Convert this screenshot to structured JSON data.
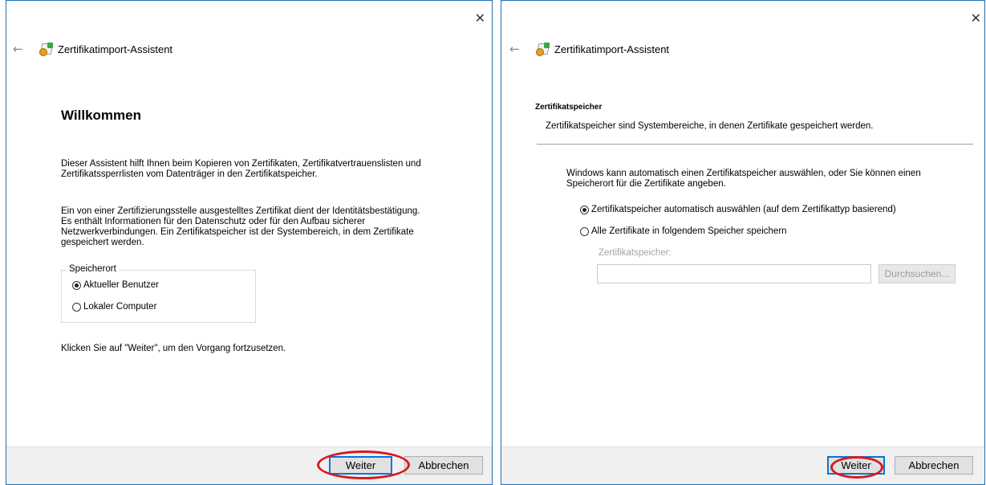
{
  "left_window": {
    "title": "Zertifikatimport-Assistent",
    "close_glyph": "✕",
    "back_glyph": "←",
    "heading": "Willkommen",
    "para1_line1": "Dieser Assistent hilft Ihnen beim Kopieren von Zertifikaten, Zertifikatvertrauenslisten und",
    "para1_line2": "Zertifikatssperrlisten vom Datenträger in den Zertifikatspeicher.",
    "para2_line1": "Ein von einer Zertifizierungsstelle ausgestelltes Zertifikat dient der Identitätsbestätigung.",
    "para2_line2": "Es enthält Informationen für den Datenschutz oder für den Aufbau sicherer",
    "para2_line3": "Netzwerkverbindungen. Ein Zertifikatspeicher ist der Systembereich, in dem Zertifikate",
    "para2_line4": "gespeichert werden.",
    "group_label": "Speicherort",
    "option_current_user": "Aktueller Benutzer",
    "option_local_computer": "Lokaler Computer",
    "selected_option": "Aktueller Benutzer",
    "continue_text": "Klicken Sie auf \"Weiter\", um den Vorgang fortzusetzen.",
    "next_label": "Weiter",
    "cancel_label": "Abbrechen"
  },
  "right_window": {
    "title": "Zertifikatimport-Assistent",
    "close_glyph": "✕",
    "back_glyph": "←",
    "section_title": "Zertifikatspeicher",
    "section_desc": "Zertifikatspeicher sind Systembereiche, in denen Zertifikate gespeichert werden.",
    "intro_line1": "Windows kann automatisch einen Zertifikatspeicher auswählen, oder Sie können einen",
    "intro_line2": "Speicherort für die Zertifikate angeben.",
    "option_auto": "Zertifikatspeicher automatisch auswählen (auf dem Zertifikattyp basierend)",
    "option_manual": "Alle Zertifikate in folgendem Speicher speichern",
    "selected_option": "Zertifikatspeicher automatisch auswählen (auf dem Zertifikattyp basierend)",
    "store_label": "Zertifikatspeicher:",
    "store_value": "",
    "browse_label": "Durchsuchen...",
    "next_label": "Weiter",
    "cancel_label": "Abbrechen"
  },
  "colors": {
    "window_border": "#1f6fb4",
    "primary_button_border": "#0078d7",
    "highlight_oval": "#d71920",
    "footer_bg": "#f0f0f0"
  },
  "icons": [
    "back-arrow-icon",
    "certificate-import-icon",
    "close-icon"
  ]
}
